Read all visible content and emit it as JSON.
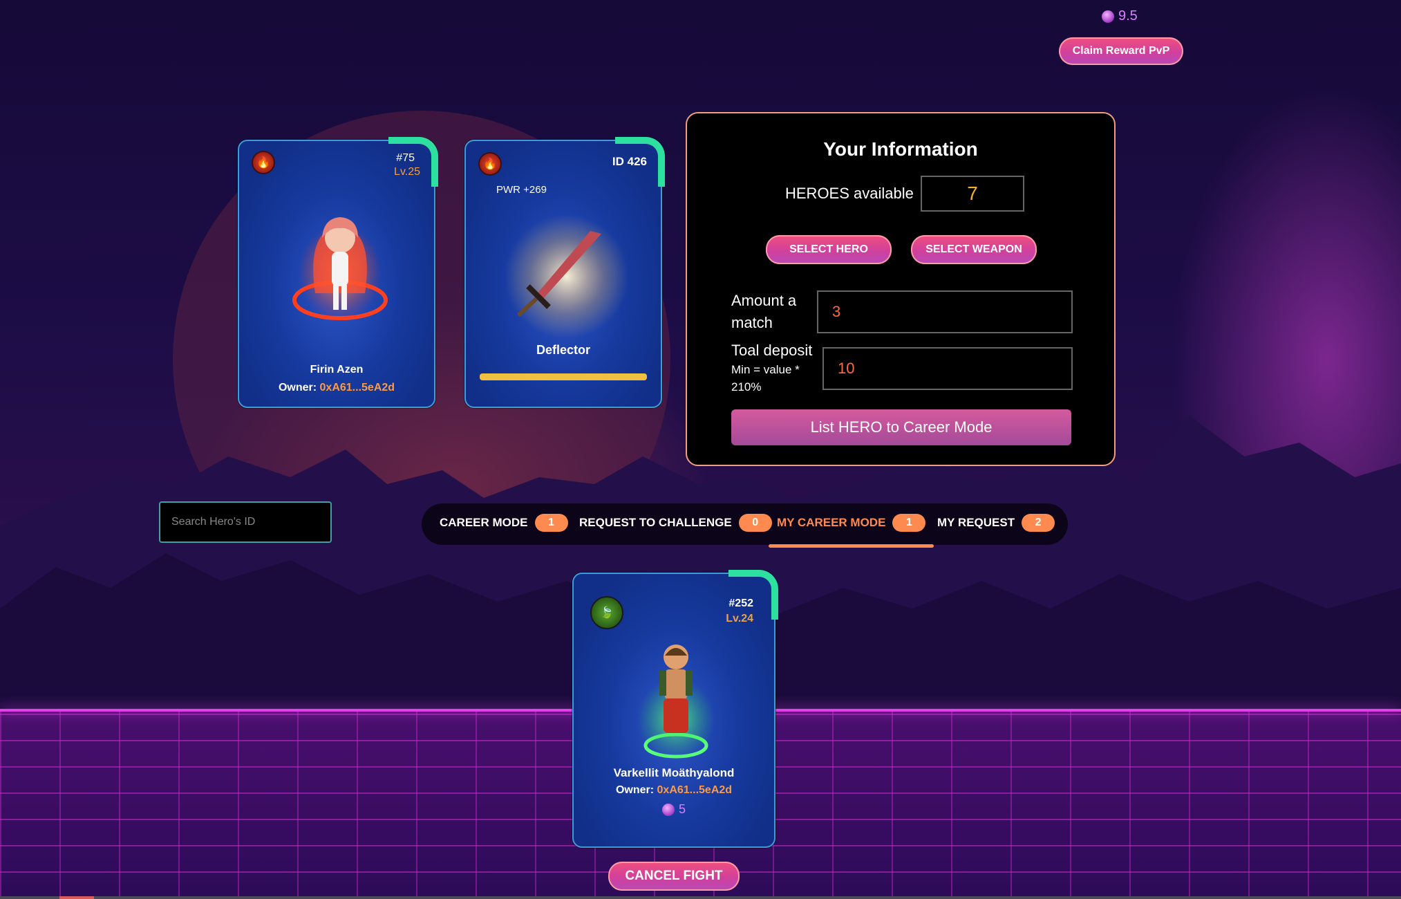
{
  "reward": {
    "balance": "9.5",
    "claim_label": "Claim Reward PvP"
  },
  "hero_card": {
    "element_icon": "fire-icon",
    "id": "#75",
    "level": "Lv.25",
    "name": "Firin Azen",
    "owner_label": "Owner:",
    "owner_address": "0xA61...5eA2d"
  },
  "weapon_card": {
    "element_icon": "fire-icon",
    "id": "ID 426",
    "power": "PWR +269",
    "name": "Deflector",
    "durability": 1.0
  },
  "info_panel": {
    "title": "Your Information",
    "heroes_available_label": "HEROES available",
    "heroes_available_value": "7",
    "select_hero_label": "SELECT HERO",
    "select_weapon_label": "SELECT WEAPON",
    "amount_label_line1": "Amount a",
    "amount_label_line2": "match",
    "amount_value": "3",
    "deposit_label": "Toal deposit",
    "deposit_sub_line1": "Min = value *",
    "deposit_sub_line2": "210%",
    "deposit_value": "10",
    "list_button_label": "List HERO to Career Mode"
  },
  "search": {
    "placeholder": "Search Hero's ID"
  },
  "tabs": [
    {
      "label": "CAREER MODE",
      "count": "1",
      "active": false
    },
    {
      "label": "REQUEST TO CHALLENGE",
      "count": "0",
      "active": false
    },
    {
      "label": "MY CAREER MODE",
      "count": "1",
      "active": true
    },
    {
      "label": "MY REQUEST",
      "count": "2",
      "active": false
    }
  ],
  "listing_card": {
    "element_icon": "leaf-icon",
    "id": "#252",
    "level": "Lv.24",
    "name": "Varkellit Moäthyalond",
    "owner_label": "Owner:",
    "owner_address": "0xA61...5eA2d",
    "amount": "5"
  },
  "cancel_label": "CANCEL FIGHT",
  "colors": {
    "accent": "#ff8a50",
    "card_corner": "#2ee0a0",
    "coin": "#d880ff"
  }
}
